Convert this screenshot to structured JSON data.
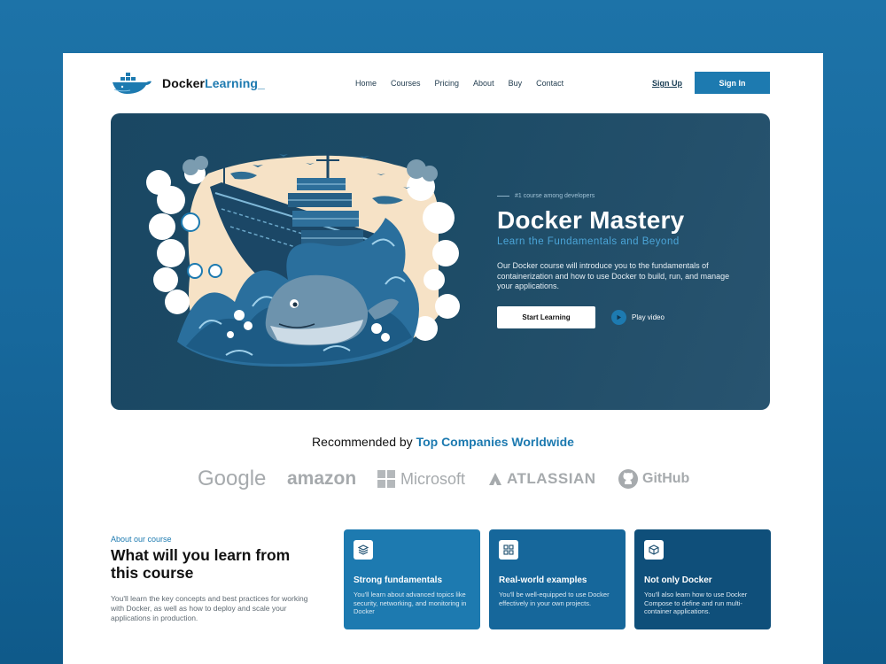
{
  "brand": {
    "name_main": "Docker",
    "name_accent": "Learning_"
  },
  "nav": {
    "items": [
      "Home",
      "Courses",
      "Pricing",
      "About",
      "Buy",
      "Contact"
    ]
  },
  "auth": {
    "signup": "Sign Up",
    "signin": "Sign In"
  },
  "hero": {
    "tagline": "#1 course among developers",
    "title": "Docker Mastery",
    "subtitle": "Learn the Fundamentals and Beyond",
    "description": "Our Docker course will introduce you to the fundamentals of containerization and how to use Docker to build, run, and manage your applications.",
    "cta": "Start Learning",
    "play_label": "Play video"
  },
  "recommended": {
    "prefix": "Recommended by ",
    "accent": "Top Companies Worldwide",
    "companies": [
      "Google",
      "amazon",
      "Microsoft",
      "ATLASSIAN",
      "GitHub"
    ]
  },
  "about": {
    "label": "About our course",
    "title": "What will you learn from this course",
    "description": "You'll learn the key concepts and best practices for working with Docker, as well as how to deploy and scale your applications in production."
  },
  "cards": [
    {
      "title": "Strong fundamentals",
      "description": "You'll  learn about advanced topics like security, networking, and monitoring in Docker",
      "icon": "layers-icon",
      "color": "#1d7ab0"
    },
    {
      "title": "Real-world examples",
      "description": "You'll be well-equipped to use Docker effectively in your own projects.",
      "icon": "grid-icon",
      "color": "#16679b"
    },
    {
      "title": "Not only Docker",
      "description": "You'll also learn how to use Docker Compose to define and run multi-container applications.",
      "icon": "box-icon",
      "color": "#0f4f7a"
    }
  ],
  "colors": {
    "accent": "#1d7ab0",
    "hero_bg": "#1c4b66",
    "page_bg": "#1a6ea3"
  }
}
